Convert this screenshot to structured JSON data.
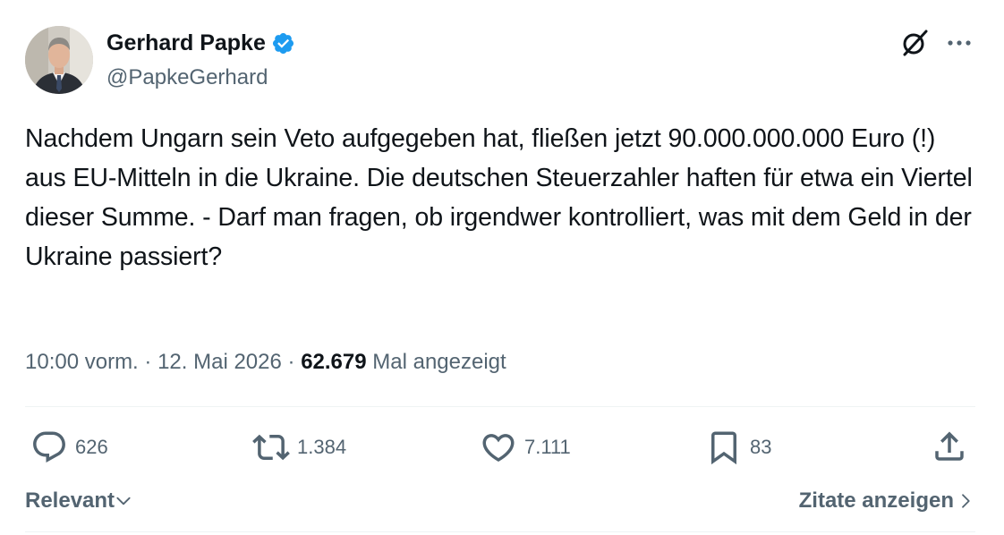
{
  "author": {
    "display_name": "Gerhard Papke",
    "handle": "@PapkeGerhard",
    "verified_icon": "verified-badge-icon",
    "verified_color": "#1d9bf0"
  },
  "tweet": {
    "text": "Nachdem Ungarn sein Veto aufgegeben hat, fließen jetzt 90.000.000.000 Euro (!) aus EU-Mitteln in die Ukraine. Die deutschen Steuerzahler haften für etwa ein Viertel dieser Summe. - Darf man fragen, ob irgendwer kontrolliert, was mit dem Geld in der Ukraine passiert?",
    "time": "10:00 vorm.",
    "date": "12. Mai 2026",
    "separator": "·",
    "views": "62.679",
    "views_label": "Mal angezeigt"
  },
  "actions": {
    "replies": "626",
    "reposts": "1.384",
    "likes": "7.111",
    "bookmarks": "83"
  },
  "footer": {
    "sort_label": "Relevant",
    "quotes_label": "Zitate anzeigen"
  },
  "colors": {
    "text_primary": "#0f1419",
    "text_secondary": "#536471",
    "divider": "#eff3f4",
    "accent": "#1d9bf0"
  }
}
